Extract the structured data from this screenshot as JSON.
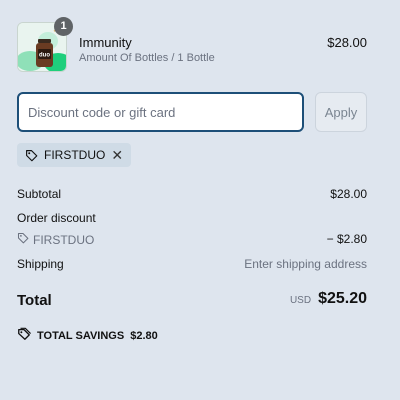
{
  "line_item": {
    "quantity": "1",
    "name": "Immunity",
    "variant": "Amount Of Bottles / 1 Bottle",
    "price": "$28.00",
    "image_label": "duo"
  },
  "discount": {
    "placeholder": "Discount code or gift card",
    "apply_label": "Apply",
    "applied_code": "FIRSTDUO"
  },
  "summary": {
    "subtotal_label": "Subtotal",
    "subtotal_value": "$28.00",
    "order_discount_label": "Order discount",
    "discount_code": "FIRSTDUO",
    "discount_value": "− $2.80",
    "shipping_label": "Shipping",
    "shipping_value": "Enter shipping address",
    "total_label": "Total",
    "currency": "USD",
    "total_value": "$25.20",
    "savings_label": "TOTAL SAVINGS",
    "savings_value": "$2.80"
  },
  "icons": {
    "tag": "tag-icon",
    "close": "close-icon",
    "savings": "savings-tag-icon"
  },
  "colors": {
    "background": "#dee5ee",
    "input_border": "#1d4f78",
    "chip_bg": "#cfdbe6",
    "badge_bg": "#5f6366"
  }
}
